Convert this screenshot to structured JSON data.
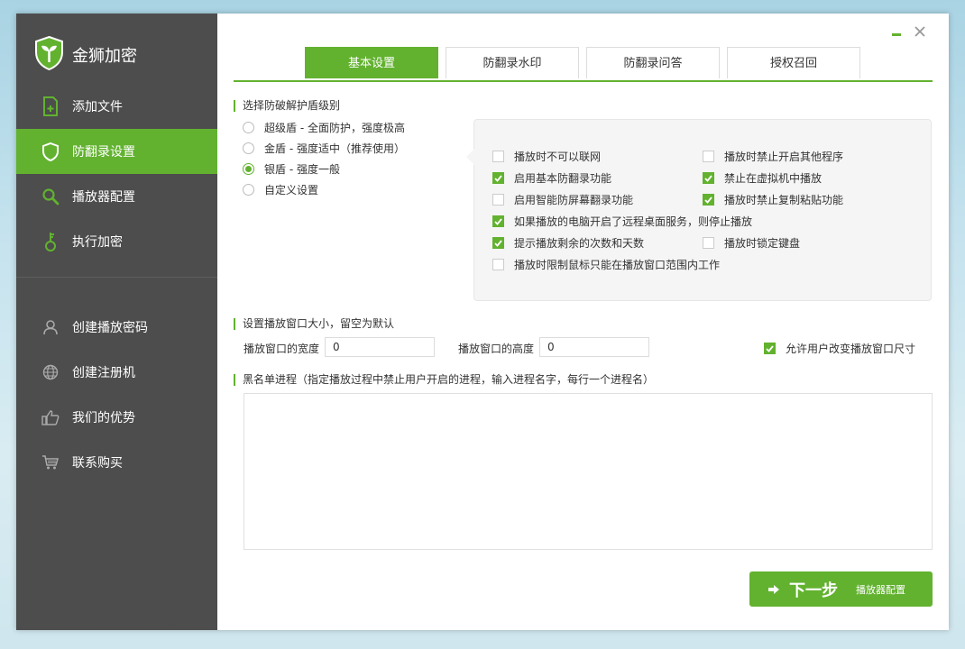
{
  "app": {
    "title": "金狮加密"
  },
  "sidebar": {
    "items": [
      {
        "label": "添加文件",
        "icon": "add-file-icon"
      },
      {
        "label": "防翻录设置",
        "icon": "shield-icon"
      },
      {
        "label": "播放器配置",
        "icon": "search-icon"
      },
      {
        "label": "执行加密",
        "icon": "key-icon"
      },
      {
        "label": "创建播放密码",
        "icon": "user-icon"
      },
      {
        "label": "创建注册机",
        "icon": "globe-icon"
      },
      {
        "label": "我们的优势",
        "icon": "thumbs-up-icon"
      },
      {
        "label": "联系购买",
        "icon": "cart-icon"
      }
    ],
    "active": "防翻录设置"
  },
  "tabs": [
    "基本设置",
    "防翻录水印",
    "防翻录问答",
    "授权召回"
  ],
  "active_tab": "基本设置",
  "shield_section": {
    "title": "选择防破解护盾级别",
    "options": [
      "超级盾 - 全面防护，强度极高",
      "金盾 - 强度适中（推荐使用）",
      "银盾 - 强度一般",
      "自定义设置"
    ],
    "selected": "银盾 - 强度一般"
  },
  "options": {
    "no_network": {
      "label": "播放时不可以联网",
      "checked": false
    },
    "forbid_other_programs": {
      "label": "播放时禁止开启其他程序",
      "checked": false
    },
    "basic_anti_record": {
      "label": "启用基本防翻录功能",
      "checked": true
    },
    "forbid_vm": {
      "label": "禁止在虚拟机中播放",
      "checked": true
    },
    "smart_anti_screen": {
      "label": "启用智能防屏幕翻录功能",
      "checked": false
    },
    "forbid_copy_paste": {
      "label": "播放时禁止复制粘贴功能",
      "checked": true
    },
    "stop_on_remote_desktop": {
      "label": "如果播放的电脑开启了远程桌面服务，则停止播放",
      "checked": true
    },
    "show_remaining": {
      "label": "提示播放剩余的次数和天数",
      "checked": true
    },
    "lock_keyboard": {
      "label": "播放时锁定键盘",
      "checked": false
    },
    "limit_mouse": {
      "label": "播放时限制鼠标只能在播放窗口范围内工作",
      "checked": false
    }
  },
  "window_size": {
    "title": "设置播放窗口大小，留空为默认",
    "width_label": "播放窗口的宽度",
    "width_value": "0",
    "height_label": "播放窗口的高度",
    "height_value": "0",
    "allow_resize": {
      "label": "允许用户改变播放窗口尺寸",
      "checked": true
    }
  },
  "blacklist": {
    "title": "黑名单进程（指定播放过程中禁止用户开启的进程，输入进程名字，每行一个进程名）",
    "value": ""
  },
  "next_button": {
    "label": "下一步",
    "sub": "播放器配置",
    "icon": "arrow-right-icon"
  },
  "colors": {
    "accent": "#62b22f",
    "sidebar_bg": "#4d4d4d"
  }
}
